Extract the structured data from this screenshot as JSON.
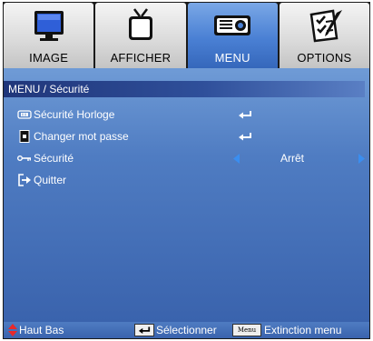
{
  "tabs": [
    {
      "label": "IMAGE",
      "icon": "monitor-icon",
      "active": false
    },
    {
      "label": "AFFICHER",
      "icon": "tv-icon",
      "active": false
    },
    {
      "label": "MENU",
      "icon": "projector-icon",
      "active": true
    },
    {
      "label": "OPTIONS",
      "icon": "checklist-icon",
      "active": false
    }
  ],
  "breadcrumb": "MENU / Sécurité",
  "items": [
    {
      "label": "Sécurité Horloge",
      "icon": "timer-icon",
      "action": "enter"
    },
    {
      "label": "Changer mot passe",
      "icon": "password-icon",
      "action": "enter"
    },
    {
      "label": "Sécurité",
      "icon": "key-icon",
      "value": "Arrêt"
    },
    {
      "label": "Quitter",
      "icon": "exit-icon"
    }
  ],
  "footer": {
    "nav_label": "Haut Bas",
    "select_label": "Sélectionner",
    "menu_key": "Menu",
    "exit_label": "Extinction menu"
  },
  "colors": {
    "accent": "#4a80d4",
    "breadcrumb_dark": "#20367a",
    "arrow": "#3a8ef0",
    "nav_arrow": "#e8282a"
  }
}
